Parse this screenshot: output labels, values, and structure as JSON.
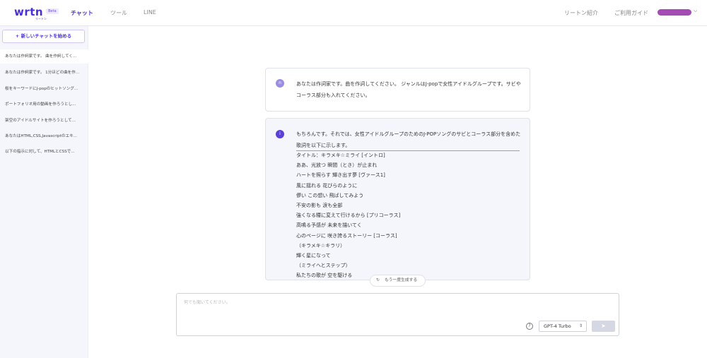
{
  "header": {
    "logo_text": "wrtn",
    "logo_sub": "リートン",
    "beta": "Beta",
    "nav": [
      "チャット",
      "ツール",
      "LINE"
    ],
    "right_links": [
      "リートン紹介",
      "ご利用ガイド"
    ],
    "icons": {
      "user_menu": "chevron-down-icon"
    }
  },
  "sidebar": {
    "new_chat": "+ 新しいチャットを始める",
    "items": [
      "あなたは作詞家です。 曲を作詞してく...",
      "あなたは作詞家です。 1分ほどの曲を作...",
      "桜をキーワードにJ-popのヒットソング...",
      "ポートフォリオ用の動画を作ろうとし...",
      "架空のアイドルサイトを作ろうとして...",
      "あなたはHTML,CSS,Javascriptのエキ...",
      "以下の指示に対して、HTMLとCSSで..."
    ]
  },
  "chat": {
    "user_avatar": "n",
    "user_message": "あなたは作詞家です。曲を作詞してください。 ジャンルはJ-popで女性アイドルグループです。サビやコーラス部分も入れてください。",
    "ai_avatar": "i",
    "ai_intro": "もちろんです。それでは、女性アイドルグループのためのJ-POPソングのサビとコーラス部分を含めた歌詞を以下に示します。",
    "lyrics": [
      "タイトル：キラメキ☆ミライ [イントロ]",
      "ああ、光放つ 瞬間（とき）が止まれ",
      "ハートを照らす 輝き出す夢 [ヴァース1]",
      "風に揺れる 花びらのように",
      "儚い この想い 飛ばしてみよう",
      "不安の影も 涙も全部",
      "強くなる糧に変えて行けるから [プリコーラス]",
      "高鳴る予感が 未来を描いてく",
      "心のページに 咲き誇るストーリー [コーラス]",
      "（キラメキ☆キラリ）",
      "輝く星になって",
      "（ミライへとステップ）",
      "私たちの歌が 空を駆ける"
    ]
  },
  "regenerate": {
    "label": "もう一度生成する",
    "icon": "refresh-icon"
  },
  "composer": {
    "placeholder": "何でも聞いてください。",
    "model": "GPT-4 Turbo",
    "help_icon": "help-icon",
    "send_icon": "send-icon"
  },
  "colors": {
    "accent": "#4a2fd6",
    "sidebar_bg": "#f5f6fb",
    "ai_bg": "#f4f6fb",
    "user_pill": "#a44bb6"
  }
}
